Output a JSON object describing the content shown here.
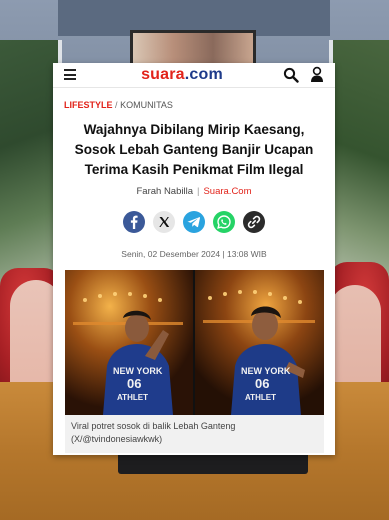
{
  "site": {
    "logo_part1": "suara",
    "logo_part2": ".com",
    "brand_color": "#e2231a",
    "secondary_color": "#1e3a8a"
  },
  "nav": {
    "menu_icon": "hamburger-icon",
    "search_icon": "search-icon",
    "user_icon": "user-icon"
  },
  "breadcrumb": {
    "category": "LIFESTYLE",
    "separator": "/",
    "subcategory": "KOMUNITAS"
  },
  "article": {
    "headline_lines": [
      "Wajahnya Dibilang Mirip Kaesang,",
      "Sosok Lebah Ganteng Banjir Ucapan",
      "Terima Kasih Penikmat Film Ilegal"
    ],
    "author": "Farah Nabilla",
    "byline_separator": "|",
    "source": "Suara.Com",
    "date": "Senin, 02 Desember 2024 | 13:08 WIB",
    "image_text": "NEW YORK 06 ATHLET",
    "caption_lines": [
      "Viral potret sosok di balik Lebah Ganteng",
      "(X/@tvindonesiawkwk)"
    ]
  },
  "share_buttons": [
    {
      "name": "facebook-icon",
      "color": "#3b5998"
    },
    {
      "name": "x-icon",
      "color": "#e6e6e6"
    },
    {
      "name": "telegram-icon",
      "color": "#2aa3df"
    },
    {
      "name": "whatsapp-icon",
      "color": "#25d366"
    },
    {
      "name": "link-icon",
      "color": "#2b2b2b"
    }
  ]
}
